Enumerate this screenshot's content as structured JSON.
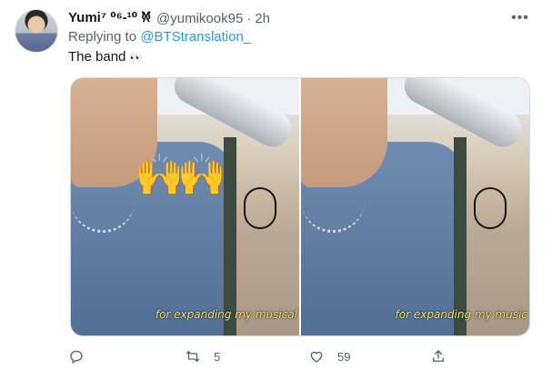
{
  "tweet": {
    "author_name": "Yumi⁷ 𐦍 ⁰⁶-¹⁰",
    "author_handle": "@yumikook95",
    "separator": "·",
    "time": "2h",
    "more_icon": "more-horizontal-icon",
    "replying_to_label": "Replying to",
    "replying_to_handle": "@BTStranslation_",
    "text": "The band",
    "text_emoji": "👀"
  },
  "media": {
    "emoji_overlay": "🙌",
    "left_caption": "for expanding my musical",
    "right_caption": "for expanding my music"
  },
  "actions": {
    "reply_count": "",
    "retweet_count": "5",
    "like_count": "59",
    "share_count": "",
    "reply_icon": "reply-icon",
    "retweet_icon": "retweet-icon",
    "like_icon": "heart-icon",
    "share_icon": "share-icon"
  },
  "colors": {
    "link": "#1d9bf0",
    "secondary_text": "#536471",
    "primary_text": "#0f1419",
    "caption": "#f4e26a"
  }
}
